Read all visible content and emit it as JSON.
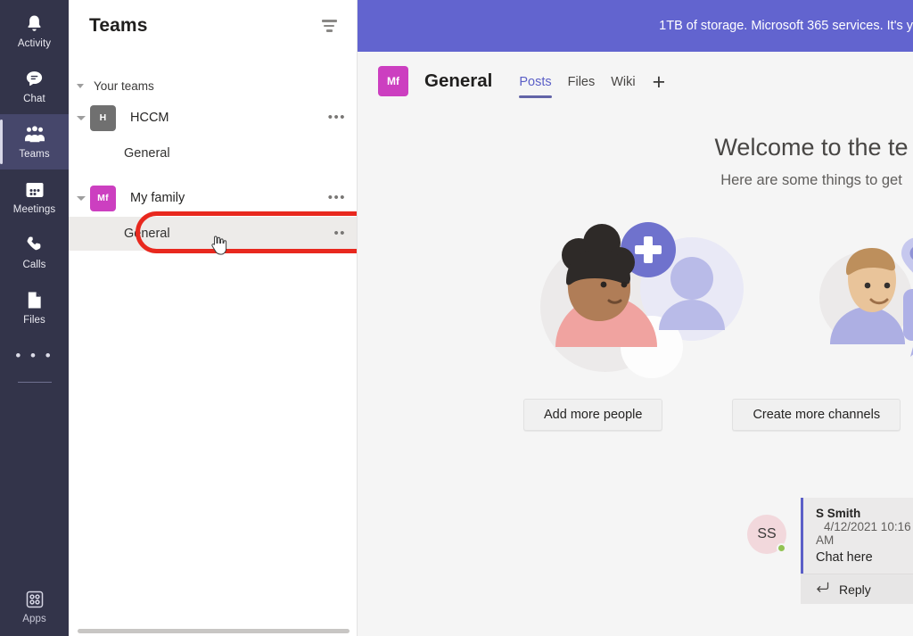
{
  "rail": {
    "items": [
      {
        "label": "Activity",
        "icon": "bell-icon",
        "selected": false
      },
      {
        "label": "Chat",
        "icon": "chat-icon",
        "selected": false
      },
      {
        "label": "Teams",
        "icon": "teams-icon",
        "selected": true
      },
      {
        "label": "Meetings",
        "icon": "calendar-icon",
        "selected": false
      },
      {
        "label": "Calls",
        "icon": "phone-icon",
        "selected": false
      },
      {
        "label": "Files",
        "icon": "file-icon",
        "selected": false
      }
    ],
    "more_label": "• • •",
    "apps_label": "Apps",
    "apps_icon": "apps-grid-icon"
  },
  "panel": {
    "title": "Teams",
    "filter_icon": "filter-icon",
    "section_label": "Your teams",
    "teams": [
      {
        "name": "HCCM",
        "initials": "H",
        "avatar_color": "#707070",
        "more_label": "•••",
        "channels": [
          {
            "name": "General",
            "active": false
          }
        ]
      },
      {
        "name": "My family",
        "initials": "Mf",
        "avatar_color": "#cc3fc0",
        "more_label": "•••",
        "channels": [
          {
            "name": "General",
            "active": true,
            "more_label": "••"
          }
        ]
      }
    ],
    "annotation_color": "#e8281e"
  },
  "main": {
    "banner_text": "1TB of storage. Microsoft 365 services. It's y",
    "banner_color": "#6264cf",
    "channel": {
      "avatar_initials": "Mf",
      "avatar_color": "#cc3fc0",
      "title": "General"
    },
    "tabs": [
      {
        "label": "Posts",
        "active": true
      },
      {
        "label": "Files",
        "active": false
      },
      {
        "label": "Wiki",
        "active": false
      }
    ],
    "tab_add_label": "+",
    "welcome_title": "Welcome to the te",
    "welcome_subtitle": "Here are some things to get",
    "cta_buttons": [
      {
        "label": "Add more people"
      },
      {
        "label": "Create more channels"
      }
    ],
    "message": {
      "avatar_initials": "SS",
      "author": "S Smith",
      "timestamp": "4/12/2021 10:16 AM",
      "text": "Chat here",
      "reply_label": "Reply",
      "reply_icon": "reply-arrow-icon",
      "presence": "available"
    }
  }
}
